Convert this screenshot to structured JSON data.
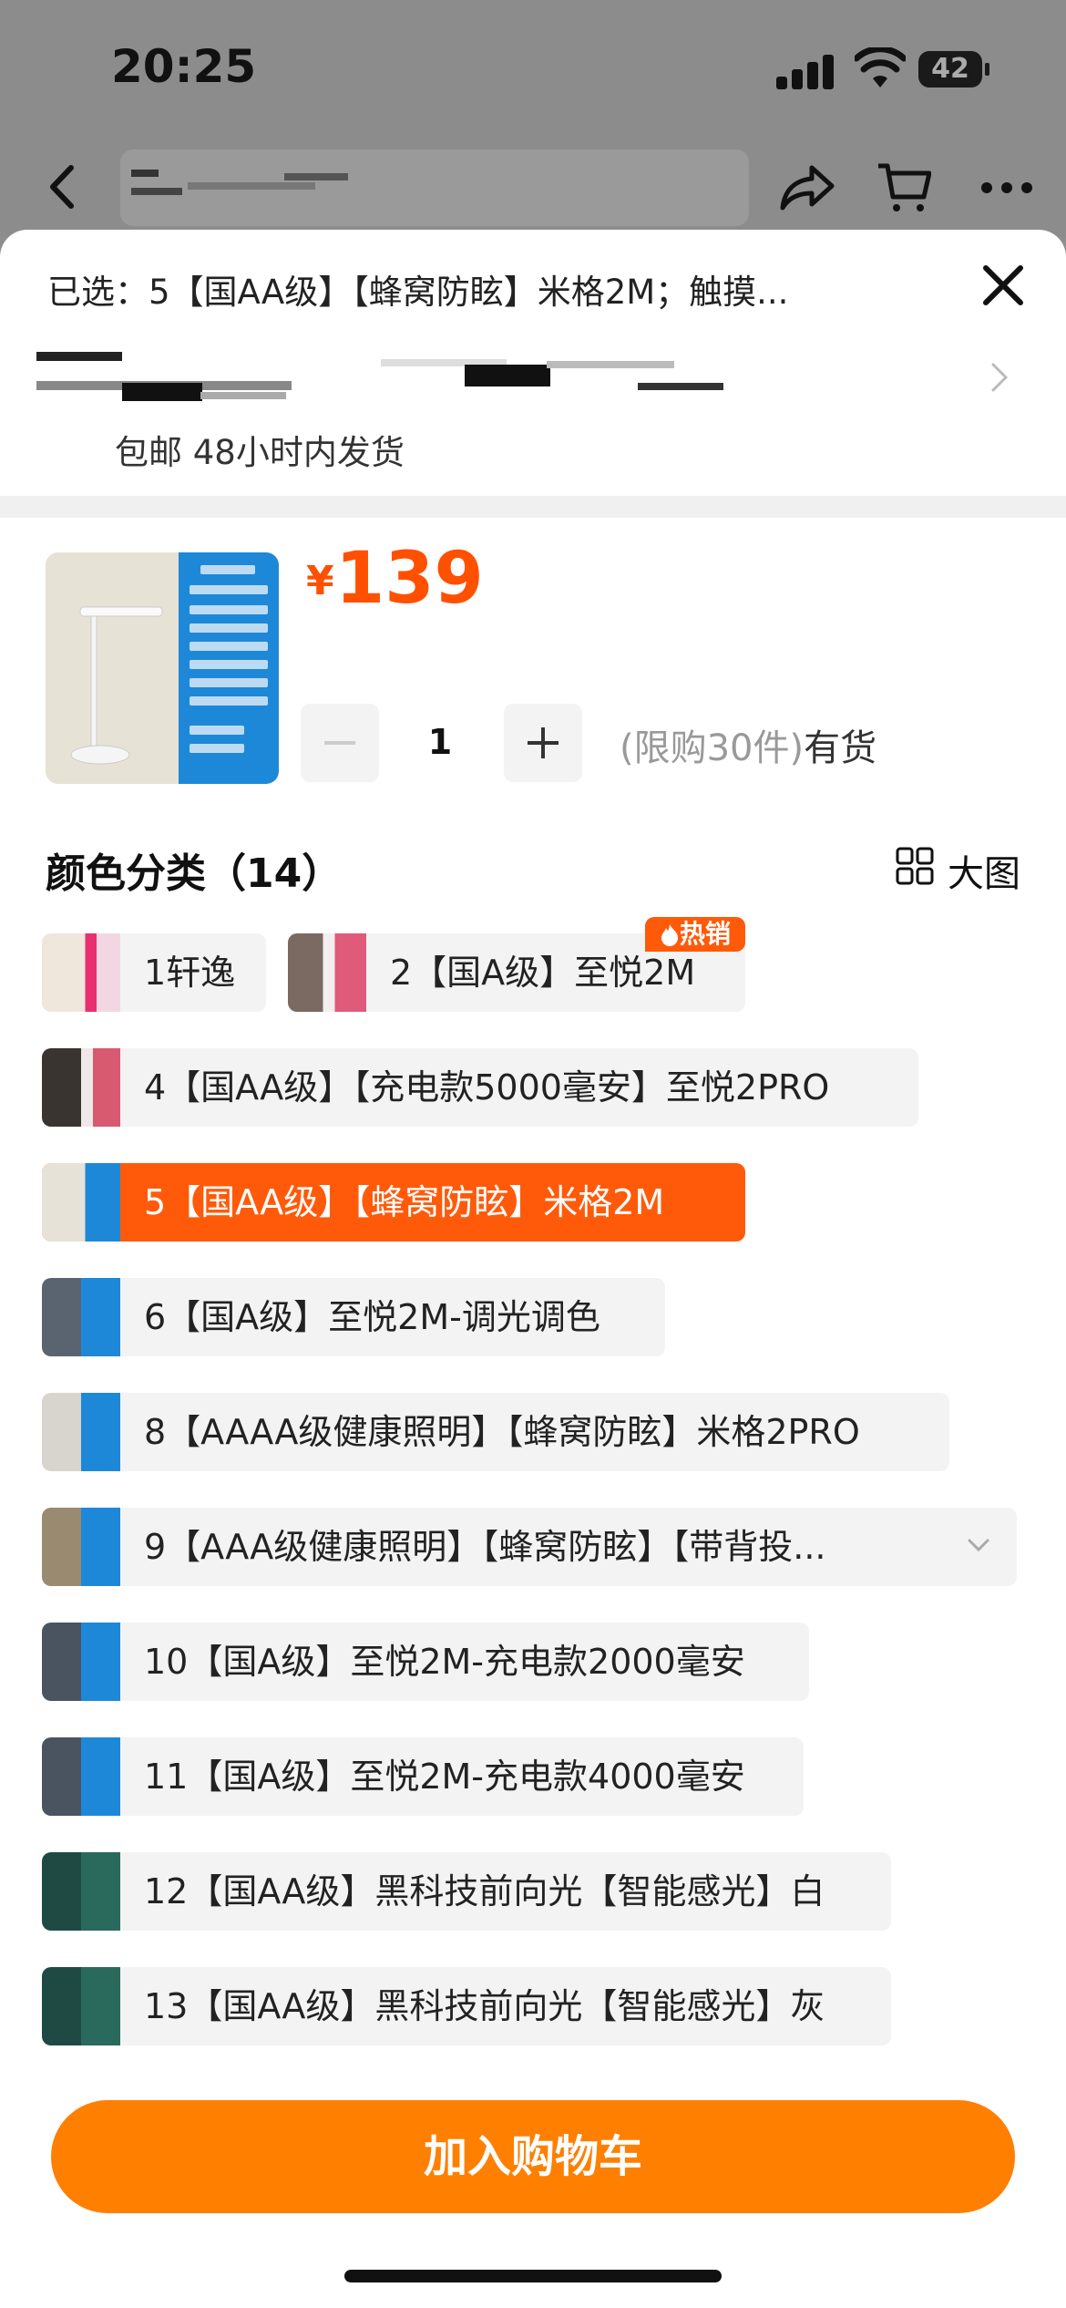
{
  "status_bar": {
    "time": "20:25",
    "battery": "42"
  },
  "sheet": {
    "selected_text": "已选：5【国AA级】【蜂窝防眩】米格2M；触摸...",
    "shipping_text": "包邮 48小时内发货"
  },
  "product": {
    "currency": "¥",
    "price": "139",
    "quantity": "1",
    "limit_text": "(限购30件)",
    "stock_text": "有货"
  },
  "colors": {
    "section_title": "颜色分类（14）",
    "big_view_label": "大图",
    "hot_badge": "热销",
    "options": [
      {
        "label": "1轩逸"
      },
      {
        "label": "2【国A级】至悦2M"
      },
      {
        "label": "4【国AA级】【充电款5000毫安】至悦2PRO"
      },
      {
        "label": "5【国AA级】【蜂窝防眩】米格2M",
        "selected": true
      },
      {
        "label": "6【国A级】至悦2M-调光调色"
      },
      {
        "label": "8【AAAA级健康照明】【蜂窝防眩】米格2PRO"
      },
      {
        "label": "9【AAA级健康照明】【蜂窝防眩】【带背投..."
      },
      {
        "label": "10【国A级】至悦2M-充电款2000毫安"
      },
      {
        "label": "11【国A级】至悦2M-充电款4000毫安"
      },
      {
        "label": "12【国AA级】黑科技前向光【智能感光】白"
      },
      {
        "label": "13【国AA级】黑科技前向光【智能感光】灰"
      }
    ]
  },
  "cta": {
    "add_to_cart": "加入购物车"
  },
  "theme": {
    "accent": "#ff5000",
    "button": "#ff7f00"
  }
}
